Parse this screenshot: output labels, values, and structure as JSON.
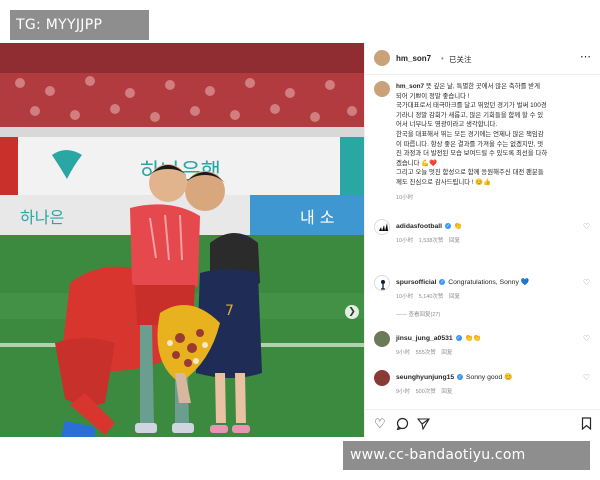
{
  "watermarks": {
    "top": "TG: MYYJJPP",
    "bottom": "www.cc-bandaotiyu.com"
  },
  "post": {
    "username": "hm_son7",
    "header_sep": "•",
    "follow_label": "已关注",
    "more_icon": "more-horizontal-icon",
    "caption_lines": [
      "뜻 깊은 날, 특별한 곳에서 많은 축하를 받게",
      "되어 기쁘이 정말 좋습니다 !",
      "국가대표로서 태극마크를 달고 뛰었던 경기가 벌써 100경",
      "기라니 정말 감회가 새롭고, 많은 기회들을 함께 할 수 있",
      "어서 너무나도 영광이라고 생각합니다.",
      "한국을 대표해서 뛰는 모든 경기에는 언제나 많은 책임감",
      "이 따릅니다. 항상 좋은 결과를 가져올 수는 없겠지만, 멋",
      "진 과정과 더 발전된 모습 보여드릴 수 있도록 최선을 다하",
      "겠습니다 💪❤️",
      "그리고 오늘 멋진 함성으로 함께 응원해주신 대전 팬분들",
      "께도 진심으로 감사드립니다 ! 😊👍"
    ],
    "caption_time": "10小时"
  },
  "comments": [
    {
      "user": "adidasfootball",
      "text": "👏",
      "verified": true,
      "time": "10小时",
      "likes": "1,538次赞",
      "reply": "回复",
      "avatar": "adidas-logo-icon"
    },
    {
      "user": "spursofficial",
      "text": "Congratulations, Sonny 💙",
      "verified": true,
      "time": "10小时",
      "likes": "5,140次赞",
      "reply": "回复",
      "replies": "—— 查看回复(27)",
      "avatar": "spurs-logo-icon"
    },
    {
      "user": "jinsu_jung_a0531",
      "text": "👏👏",
      "verified": true,
      "time": "9小时",
      "likes": "555次赞",
      "reply": "回复",
      "avatar": "user-avatar-icon"
    },
    {
      "user": "seunghyunjung15",
      "text": "Sonny good 😊",
      "verified": true,
      "time": "9小时",
      "likes": "500次赞",
      "reply": "回复",
      "avatar": "user-avatar-icon"
    }
  ],
  "actions": {
    "like": "heart-icon",
    "comment": "comment-icon",
    "share": "share-icon",
    "save": "bookmark-icon"
  },
  "photo": {
    "banner_text": "하나은행",
    "banner_text_2": "하나은",
    "board_text": "내 소",
    "jersey_number": "7"
  },
  "colors": {
    "pitch": "#3c8a3f",
    "kit_red": "#d9352f",
    "banner_teal": "#2aa7a2",
    "verified_blue": "#3897f0"
  }
}
